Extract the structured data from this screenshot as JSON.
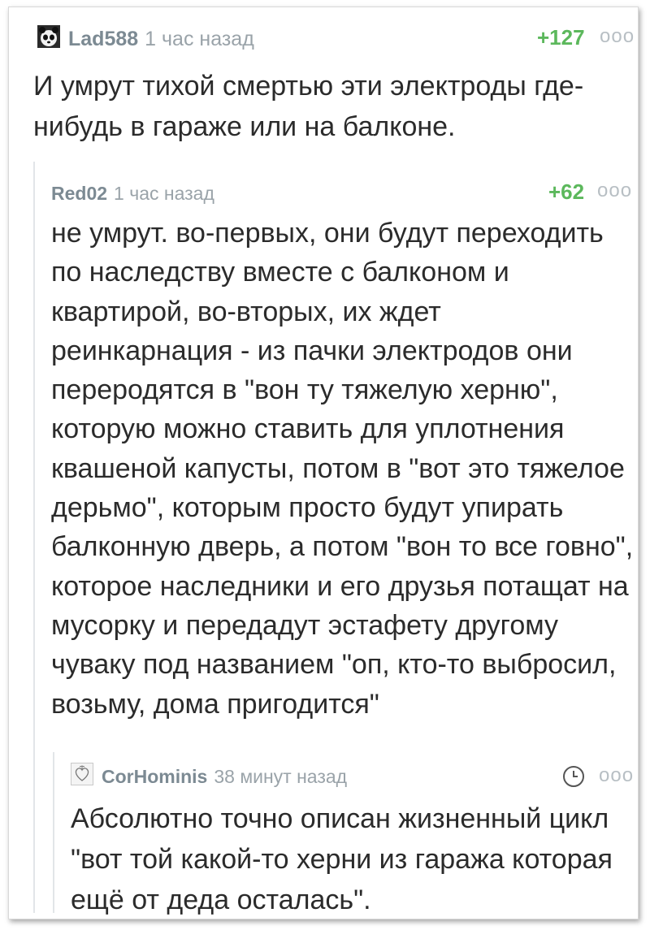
{
  "comments": [
    {
      "username": "Lad588",
      "time": "1 час назад",
      "rating": "+127",
      "avatar_icon": "panda-avatar-icon",
      "more_icon": "ooo",
      "text": "И умрут тихой смертью эти электроды где-\nнибудь в гараже или на балконе."
    },
    {
      "username": "Red02",
      "time": "1 час назад",
      "rating": "+62",
      "more_icon": "ooo",
      "text": "не умрут. во-первых, они будут переходить\nпо наследству вместе с балконом и\nквартирой, во-вторых, их ждет\nреинкарнация - из пачки электродов они\nпереродятся в \"вон ту тяжелую херню\",\nкоторую можно ставить для уплотнения\nквашеной капусты, потом в \"вот это тяжелое\nдерьмо\", которым просто будут упирать\nбалконную дверь, а потом \"вон то все говно\",\nкоторое наследники и его друзья потащат на\nмусорку и передадут эстафету другому\nчуваку под названием \"оп, кто-то выбросил,\nвозьму, дома пригодится\""
    },
    {
      "username": "CorHominis",
      "time": "38 минут назад",
      "avatar_icon": "heart-sketch-avatar-icon",
      "status_icon": "clock-icon",
      "more_icon": "ooo",
      "text": "Абсолютно точно описан жизненный цикл\n\"вот той какой-то херни из гаража которая\nещё от деда осталась\"."
    }
  ],
  "colors": {
    "username": "#7c8a93",
    "rating_positive": "#5cb85c",
    "body_text": "#2b2b2b",
    "muted": "#9aa3a9"
  }
}
